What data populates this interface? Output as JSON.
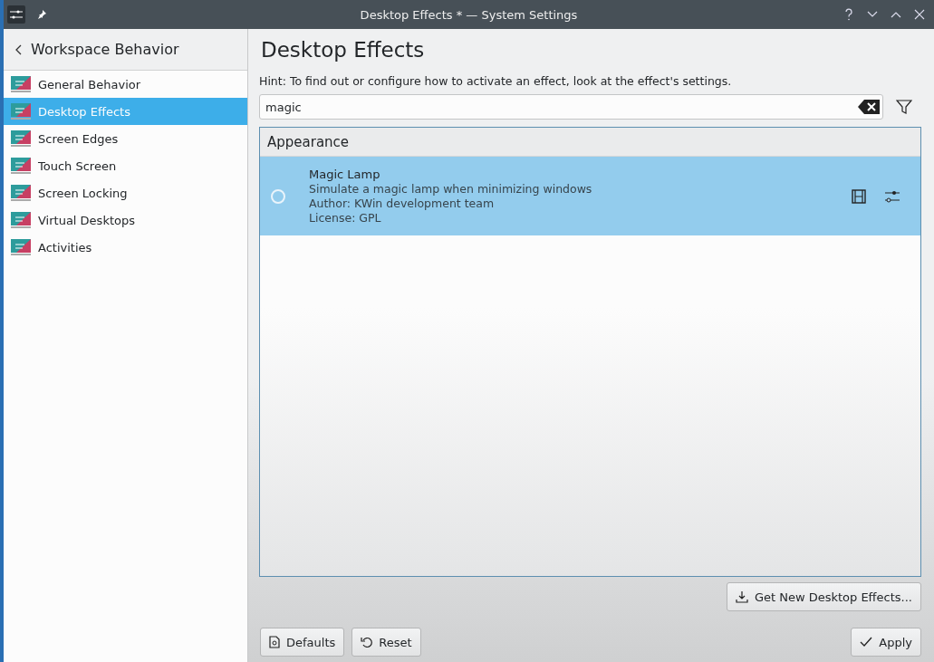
{
  "window": {
    "title": "Desktop Effects * — System Settings"
  },
  "sidebar": {
    "back_title": "Workspace Behavior",
    "items": [
      {
        "label": "General Behavior",
        "selected": false
      },
      {
        "label": "Desktop Effects",
        "selected": true
      },
      {
        "label": "Screen Edges",
        "selected": false
      },
      {
        "label": "Touch Screen",
        "selected": false
      },
      {
        "label": "Screen Locking",
        "selected": false
      },
      {
        "label": "Virtual Desktops",
        "selected": false
      },
      {
        "label": "Activities",
        "selected": false
      }
    ]
  },
  "page": {
    "title": "Desktop Effects",
    "hint": "Hint: To find out or configure how to activate an effect, look at the effect's settings.",
    "search": {
      "value": "magic"
    },
    "categories": [
      {
        "name": "Appearance",
        "effects": [
          {
            "name": "Magic Lamp",
            "description": "Simulate a magic lamp when minimizing windows",
            "author": "Author: KWin development team",
            "license": "License: GPL",
            "enabled": false,
            "selected": true
          }
        ]
      }
    ],
    "get_new_button": "Get New Desktop Effects..."
  },
  "buttons": {
    "defaults": "Defaults",
    "reset": "Reset",
    "apply": "Apply"
  }
}
